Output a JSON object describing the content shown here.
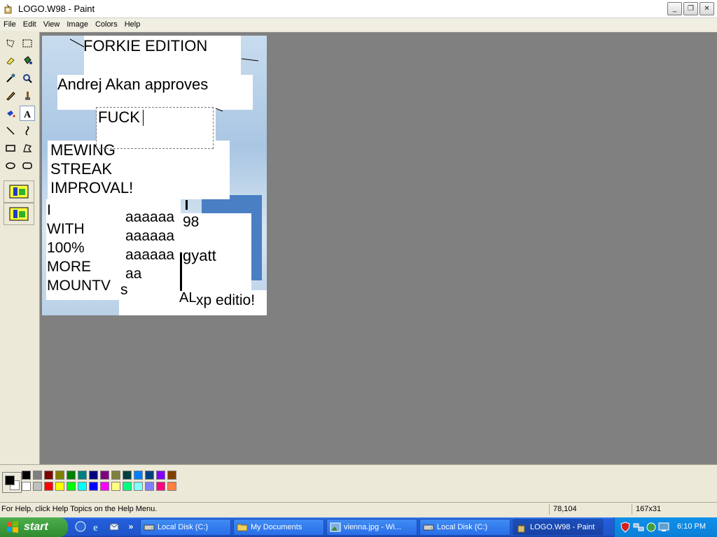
{
  "window": {
    "title": "LOGO.W98 - Paint",
    "buttons": {
      "minimize": "_",
      "maximize": "❐",
      "close": "✕"
    }
  },
  "menubar": {
    "items": [
      "File",
      "Edit",
      "View",
      "Image",
      "Colors",
      "Help"
    ]
  },
  "toolbox": {
    "tools": [
      "free-select-icon",
      "rect-select-icon",
      "eraser-icon",
      "fill-icon",
      "color-picker-icon",
      "magnifier-icon",
      "pencil-icon",
      "brush-icon",
      "airbrush-icon",
      "text-icon",
      "line-icon",
      "curve-icon",
      "rectangle-icon",
      "polygon-icon",
      "ellipse-icon",
      "rounded-rect-icon"
    ],
    "active_tool": "text-icon"
  },
  "canvas_texts": {
    "forkie": "FORKIE EDITION",
    "andrej": "Andrej Akan approves",
    "fuck": "FUCK",
    "mewing": "MEWING\nSTREAK\nIMPROVAL!",
    "with": "I\nWITH\n100%\nMORE\nMOUNTV",
    "aaa": "aaaaaa\naaaaaa\naaaaaa\naa",
    "w98": "98",
    "gyatt": "gyatt",
    "xp": "xp editio!",
    "al": "AL",
    "s": "s"
  },
  "palette": {
    "foreground": "#000000",
    "background": "#ffffff",
    "colors_top": [
      "#000000",
      "#808080",
      "#800000",
      "#808000",
      "#008000",
      "#008080",
      "#000080",
      "#800080",
      "#808040",
      "#004040",
      "#0080ff",
      "#004080",
      "#8000ff",
      "#804000"
    ],
    "colors_bottom": [
      "#ffffff",
      "#c0c0c0",
      "#ff0000",
      "#ffff00",
      "#00ff00",
      "#00ffff",
      "#0000ff",
      "#ff00ff",
      "#ffff80",
      "#00ff80",
      "#80ffff",
      "#8080ff",
      "#ff0080",
      "#ff8040"
    ]
  },
  "statusbar": {
    "help": "For Help, click Help Topics on the Help Menu.",
    "coords": "78,104",
    "size": "167x31"
  },
  "taskbar": {
    "start": "start",
    "tasks": [
      {
        "label": "Local Disk (C:)",
        "icon": "drive-icon"
      },
      {
        "label": "My Documents",
        "icon": "folder-icon"
      },
      {
        "label": "vienna.jpg - Wi...",
        "icon": "image-icon"
      },
      {
        "label": "Local Disk (C:)",
        "icon": "drive-icon"
      },
      {
        "label": "LOGO.W98 - Paint",
        "icon": "paint-icon"
      }
    ],
    "more": "»",
    "clock": "6:10 PM"
  }
}
